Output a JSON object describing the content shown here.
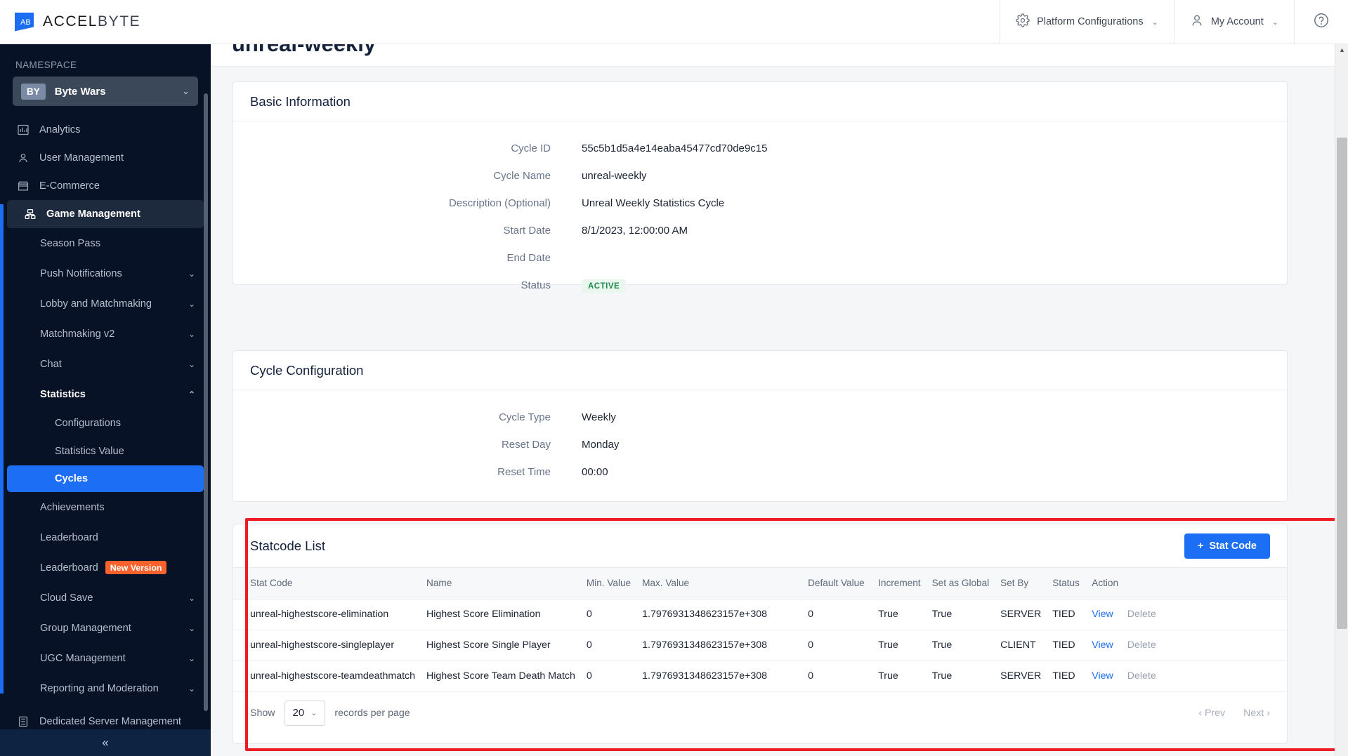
{
  "header": {
    "brand": "ACCELBYTE",
    "brand_first": "ACCEL",
    "brand_second": "BYTE",
    "platform_configurations": "Platform Configurations",
    "my_account": "My Account",
    "help": "?",
    "chevron": "⌄"
  },
  "sidebar": {
    "namespace_label": "NAMESPACE",
    "namespace_badge": "BY",
    "namespace_name": "Byte Wars",
    "collapse": "«",
    "top_items": [
      {
        "label": "Analytics",
        "icon": "chart-icon"
      },
      {
        "label": "User Management",
        "icon": "user-icon"
      },
      {
        "label": "E-Commerce",
        "icon": "store-icon"
      },
      {
        "label": "Game Management",
        "icon": "gamepad-icon"
      }
    ],
    "game_management_children": [
      {
        "label": "Season Pass",
        "expandable": false
      },
      {
        "label": "Push Notifications",
        "expandable": true
      },
      {
        "label": "Lobby and Matchmaking",
        "expandable": true
      },
      {
        "label": "Matchmaking v2",
        "expandable": true
      },
      {
        "label": "Chat",
        "expandable": true
      },
      {
        "label": "Statistics",
        "expandable": true,
        "expanded": true
      }
    ],
    "statistics_children": [
      {
        "label": "Configurations",
        "selected": false
      },
      {
        "label": "Statistics Value",
        "selected": false
      },
      {
        "label": "Cycles",
        "selected": true
      }
    ],
    "after_statistics": [
      {
        "label": "Achievements",
        "expandable": false
      },
      {
        "label": "Leaderboard",
        "expandable": false
      },
      {
        "label": "Leaderboard",
        "expandable": false,
        "badge": "New Version"
      },
      {
        "label": "Cloud Save",
        "expandable": true
      },
      {
        "label": "Group Management",
        "expandable": true
      },
      {
        "label": "UGC Management",
        "expandable": true
      },
      {
        "label": "Reporting and Moderation",
        "expandable": true
      }
    ],
    "bottom_items": [
      {
        "label": "Dedicated Server Management",
        "icon": "server-icon"
      }
    ]
  },
  "page": {
    "title": "unreal-weekly"
  },
  "basic_information": {
    "title": "Basic Information",
    "fields": [
      {
        "label": "Cycle ID",
        "value": "55c5b1d5a4e14eaba45477cd70de9c15"
      },
      {
        "label": "Cycle Name",
        "value": "unreal-weekly"
      },
      {
        "label": "Description (Optional)",
        "value": "Unreal Weekly Statistics Cycle"
      },
      {
        "label": "Start Date",
        "value": "8/1/2023, 12:00:00 AM"
      },
      {
        "label": "End Date",
        "value": ""
      }
    ],
    "status_label": "Status",
    "status_value": "ACTIVE"
  },
  "cycle_configuration": {
    "title": "Cycle Configuration",
    "fields": [
      {
        "label": "Cycle Type",
        "value": "Weekly"
      },
      {
        "label": "Reset Day",
        "value": "Monday"
      },
      {
        "label": "Reset Time",
        "value": "00:00"
      }
    ]
  },
  "statcode_list": {
    "title": "Statcode List",
    "add_button": "Stat Code",
    "add_button_icon": "+",
    "columns": [
      "Stat Code",
      "Name",
      "Min. Value",
      "Max. Value",
      "Default Value",
      "Increment",
      "Set as Global",
      "Set By",
      "Status",
      "Action"
    ],
    "rows": [
      {
        "stat_code": "unreal-highestscore-elimination",
        "name": "Highest Score Elimination",
        "min_value": "0",
        "max_value": "1.7976931348623157e+308",
        "default_value": "0",
        "increment": "True",
        "set_as_global": "True",
        "set_by": "SERVER",
        "status": "TIED",
        "action_view": "View",
        "action_delete": "Delete"
      },
      {
        "stat_code": "unreal-highestscore-singleplayer",
        "name": "Highest Score Single Player",
        "min_value": "0",
        "max_value": "1.7976931348623157e+308",
        "default_value": "0",
        "increment": "True",
        "set_as_global": "True",
        "set_by": "CLIENT",
        "status": "TIED",
        "action_view": "View",
        "action_delete": "Delete"
      },
      {
        "stat_code": "unreal-highestscore-teamdeathmatch",
        "name": "Highest Score Team Death Match",
        "min_value": "0",
        "max_value": "1.7976931348623157e+308",
        "default_value": "0",
        "increment": "True",
        "set_as_global": "True",
        "set_by": "SERVER",
        "status": "TIED",
        "action_view": "View",
        "action_delete": "Delete"
      }
    ],
    "footer": {
      "show_label": "Show",
      "page_size": "20",
      "records_label": "records per page",
      "prev": "‹ Prev",
      "next": "Next ›"
    }
  },
  "annotation": {
    "highlight_color": "#ee1c25"
  },
  "colors": {
    "accent_blue": "#1c6ef5",
    "sidebar_bg": "#081226",
    "badge_orange": "#f9622c",
    "status_green_text": "#1f8a4c",
    "status_green_bg": "#eaf7ef"
  }
}
